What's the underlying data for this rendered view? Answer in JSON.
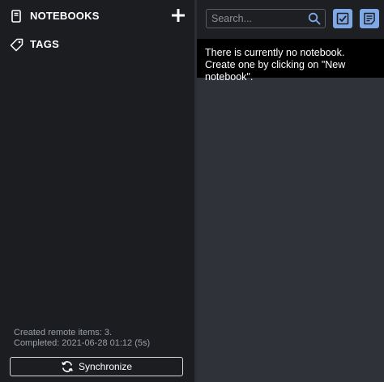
{
  "sidebar": {
    "notebooks_label": "NOTEBOOKS",
    "tags_label": "TAGS",
    "icons": {
      "notebook": "notebook-icon",
      "tag": "tag-icon",
      "add": "plus-icon"
    },
    "sync_status": {
      "line1": "Created remote items: 3.",
      "line2": "Completed: 2021-06-28 01:12 (5s)"
    },
    "sync_button_label": "Synchronize"
  },
  "note_list": {
    "search_placeholder": "Search...",
    "empty_message": "There is currently no notebook. Create one by clicking on \"New notebook\".",
    "new_todo_button": "new-todo-icon",
    "new_note_button": "new-note-icon"
  },
  "colors": {
    "sidebar_bg": "#1c1d20",
    "list_bg": "#2f3239",
    "accent": "#7ea8e6",
    "message_bg": "#000000"
  }
}
